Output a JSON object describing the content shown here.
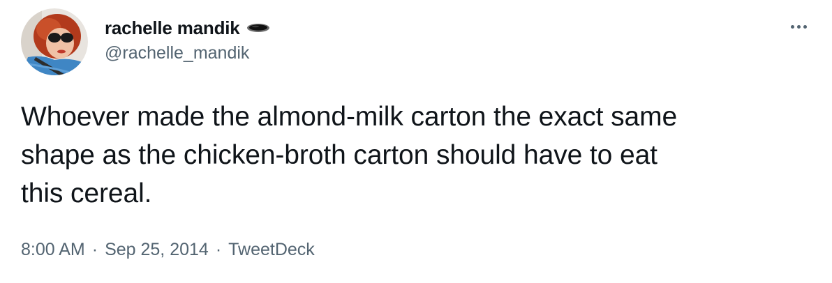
{
  "tweet": {
    "author": {
      "display_name": "rachelle mandik",
      "handle": "@rachelle_mandik",
      "name_icon": "pothole-icon"
    },
    "more_icon": "more-icon",
    "text": "Whoever made the almond-milk carton the exact same\nshape as the chicken-broth carton should have to eat\nthis cereal.",
    "time": "8:00 AM",
    "separator": "·",
    "date": "Sep 25, 2014",
    "source": "TweetDeck"
  },
  "colors": {
    "text": "#0f1419",
    "secondary": "#536471",
    "background": "#ffffff"
  }
}
